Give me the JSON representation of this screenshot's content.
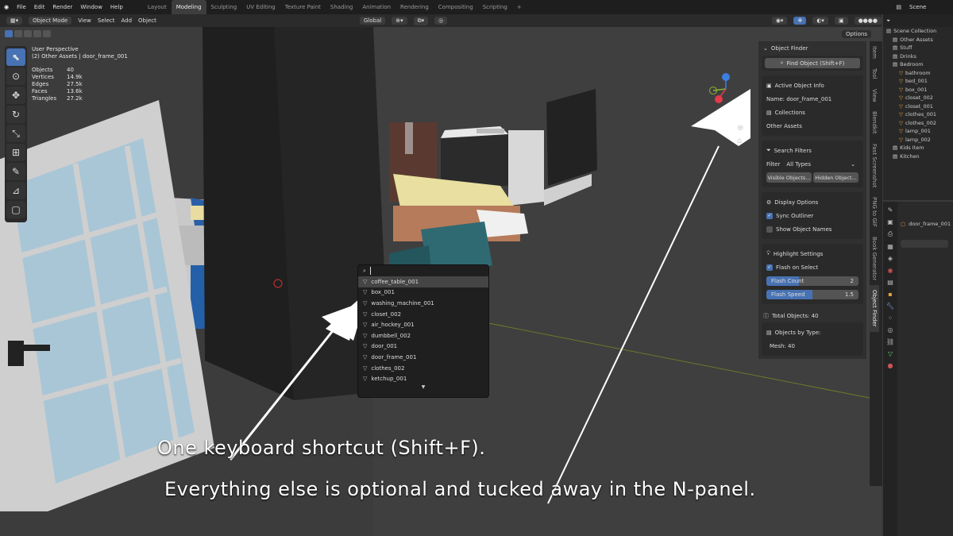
{
  "topbar": {
    "menus": [
      "File",
      "Edit",
      "Render",
      "Window",
      "Help"
    ],
    "workspaces": [
      "Layout",
      "Modeling",
      "Sculpting",
      "UV Editing",
      "Texture Paint",
      "Shading",
      "Animation",
      "Rendering",
      "Compositing",
      "Scripting"
    ],
    "active_workspace": "Modeling",
    "scene": "Scene"
  },
  "header": {
    "mode": "Object Mode",
    "menus": [
      "View",
      "Select",
      "Add",
      "Object"
    ],
    "orientation": "Global",
    "options": "Options"
  },
  "viewport": {
    "view_name": "User Perspective",
    "collection_path": "(2) Other Assets | door_frame_001",
    "stats": [
      {
        "label": "Objects",
        "value": "40"
      },
      {
        "label": "Vertices",
        "value": "14.9k"
      },
      {
        "label": "Edges",
        "value": "27.5k"
      },
      {
        "label": "Faces",
        "value": "13.6k"
      },
      {
        "label": "Triangles",
        "value": "27.2k"
      }
    ]
  },
  "search_popup": {
    "results": [
      "coffee_table_001",
      "box_001",
      "washing_machine_001",
      "closet_002",
      "air_hockey_001",
      "dumbbell_002",
      "door_001",
      "door_frame_001",
      "clothes_002",
      "ketchup_001"
    ],
    "highlighted_index": 0
  },
  "npanel": {
    "title": "Object Finder",
    "find_button": "Find Object (Shift+F)",
    "active_header": "Active Object Info",
    "name_label": "Name: door_frame_001",
    "collections_header": "Collections",
    "collection_value": "Other Assets",
    "filters_header": "Search Filters",
    "filter_label": "Filter",
    "filter_value": "All Types",
    "visible_btn": "Visible Objects...",
    "hidden_btn": "Hidden Object...",
    "display_header": "Display Options",
    "sync_outliner": "Sync Outliner",
    "show_names": "Show Object Names",
    "highlight_header": "Highlight Settings",
    "flash_select": "Flash on Select",
    "flash_count_label": "Flash Count",
    "flash_count_value": "2",
    "flash_speed_label": "Flash Speed",
    "flash_speed_value": "1.5",
    "flash_count_fraction": 0.35,
    "flash_speed_fraction": 0.5,
    "total_objects": "Total Objects: 40",
    "by_type_header": "Objects by Type:",
    "mesh_count": "Mesh: 40"
  },
  "vertical_tabs": [
    "Item",
    "Tool",
    "View",
    "Blendkit",
    "Fast Screenshot",
    "PNG to GIF",
    "Book Generator",
    "Object Finder"
  ],
  "outliner": {
    "title": "Scene Collection",
    "rows": [
      "Other Assets",
      "Stuff",
      "Drinks",
      "Bedroom",
      "bathroom",
      "bed_001",
      "box_001",
      "closet_002",
      "closet_001",
      "clothes_001",
      "clothes_002",
      "lamp_001",
      "lamp_002",
      "Kids Item",
      "Kitchen"
    ]
  },
  "properties": {
    "object_name": "door_frame_001"
  },
  "captions": {
    "line1": "One keyboard shortcut (Shift+F).",
    "line2": "Everything else is optional and tucked away in the N-panel."
  },
  "colors": {
    "accent": "#4772b3",
    "orange": "#e8a33c"
  }
}
